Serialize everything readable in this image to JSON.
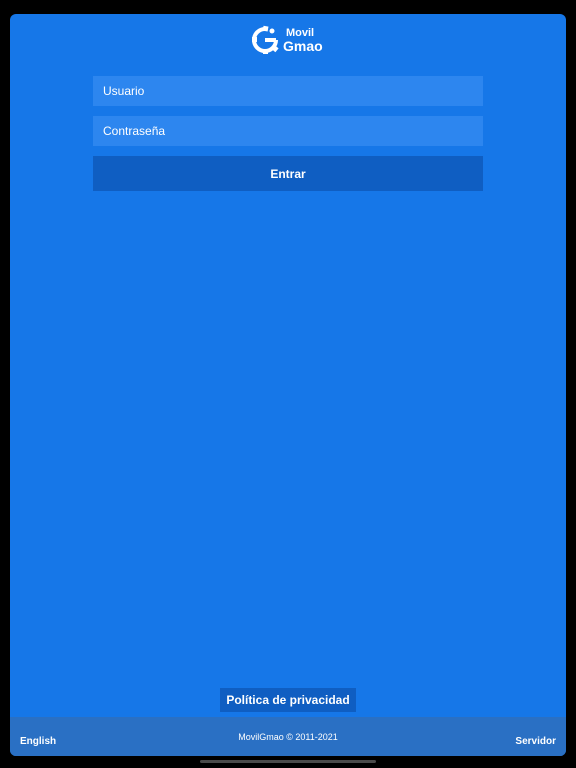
{
  "brand": {
    "line1": "Movil",
    "line2": "Gmao",
    "icon": "gear-g-logo-icon"
  },
  "login": {
    "username_placeholder": "Usuario",
    "password_placeholder": "Contraseña",
    "enter_label": "Entrar"
  },
  "privacy_label": "Política de privacidad",
  "footer": {
    "language": "English",
    "copyright": "MovilGmao © 2011-2021",
    "server": "Servidor"
  },
  "colors": {
    "background": "#1677e8",
    "field": "#2d86ef",
    "button": "#0f5ec2",
    "footer": "#2a70c4"
  }
}
